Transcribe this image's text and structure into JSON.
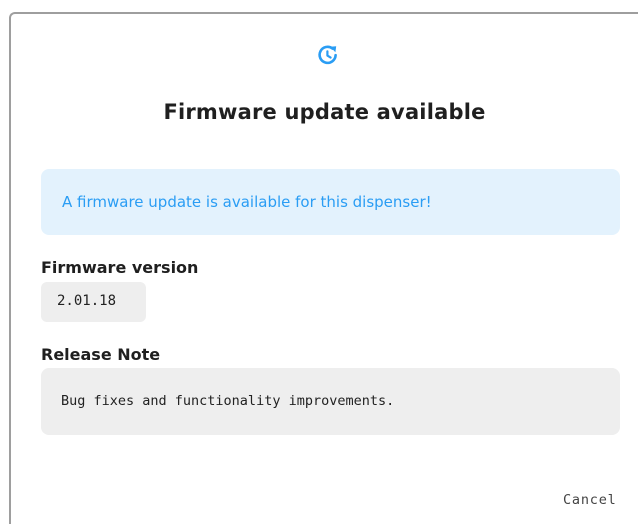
{
  "dialog": {
    "icon": "update-clock-icon",
    "title": "Firmware update available",
    "alert": {
      "text": "A firmware update is available for this dispenser!",
      "color": "#2a9df4",
      "background": "#e3f2fd"
    },
    "firmware": {
      "label": "Firmware version",
      "version": "2.01.18"
    },
    "release_note": {
      "label": "Release Note",
      "text": "Bug fixes and functionality improvements."
    },
    "actions": {
      "cancel_label": "Cancel"
    }
  },
  "colors": {
    "accent": "#2a9df4"
  }
}
